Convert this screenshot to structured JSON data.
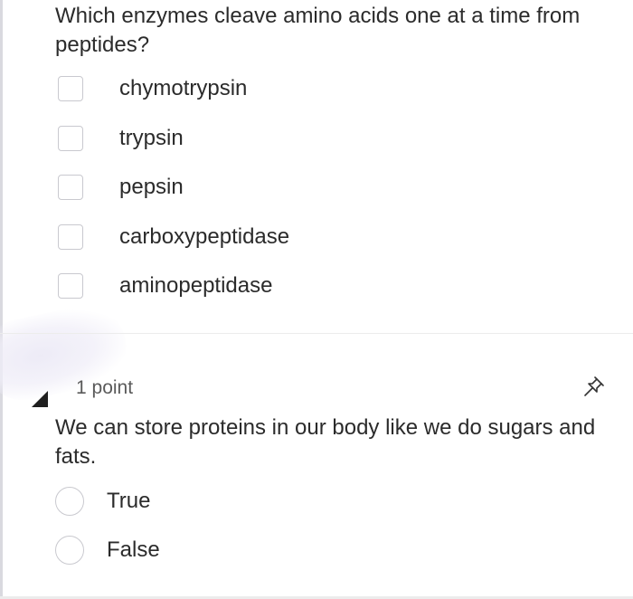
{
  "question1": {
    "text": "Which enzymes cleave amino acids one at a time from peptides?",
    "options": [
      {
        "label": "chymotrypsin",
        "checked": false
      },
      {
        "label": "trypsin",
        "checked": false
      },
      {
        "label": "pepsin",
        "checked": false
      },
      {
        "label": "carboxypeptidase",
        "checked": false
      },
      {
        "label": "aminopeptidase",
        "checked": false
      }
    ]
  },
  "question2": {
    "points": "1 point",
    "text": "We can store proteins in our body like we do sugars and fats.",
    "options": [
      {
        "label": "True",
        "selected": false
      },
      {
        "label": "False",
        "selected": false
      }
    ],
    "icon": "pin-icon"
  },
  "colors": {
    "text": "#2b2b2b",
    "border": "#c9c9cf",
    "divider": "#ececec"
  }
}
